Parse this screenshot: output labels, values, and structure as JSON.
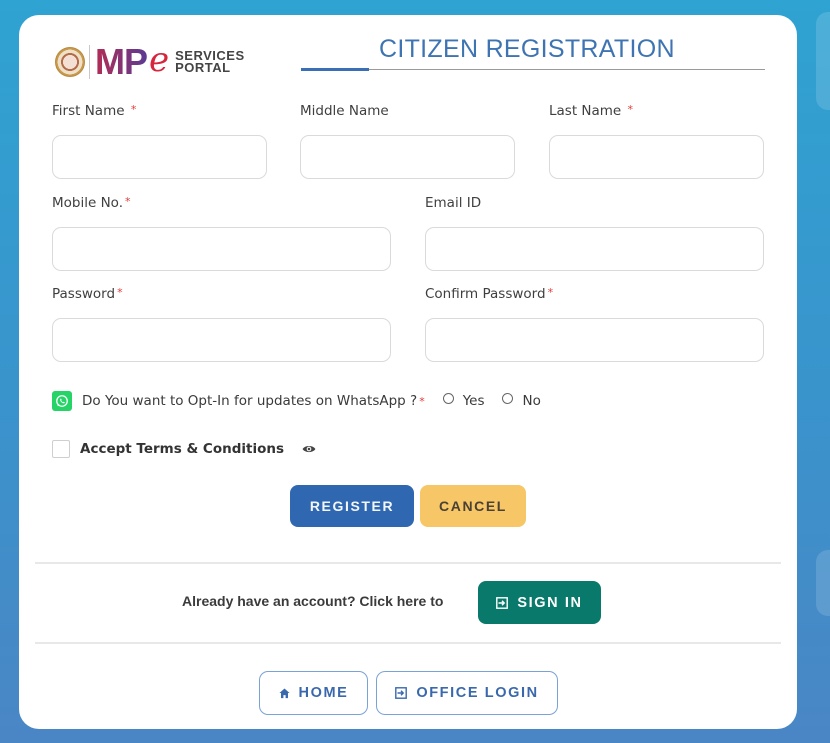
{
  "header": {
    "logo": {
      "mp": "MP",
      "e": "e",
      "line1": "SERVICES",
      "line2": "PORTAL",
      "emblem_icon": "mp-state-emblem"
    },
    "title": "CITIZEN REGISTRATION"
  },
  "form": {
    "required_marker": "*",
    "first_name": {
      "label": "First Name",
      "required": true,
      "value": "",
      "placeholder": ""
    },
    "middle_name": {
      "label": "Middle Name",
      "required": false,
      "value": "",
      "placeholder": ""
    },
    "last_name": {
      "label": "Last Name",
      "required": true,
      "value": "",
      "placeholder": ""
    },
    "mobile": {
      "label": "Mobile No.",
      "required": true,
      "value": "",
      "placeholder": ""
    },
    "email": {
      "label": "Email ID",
      "required": false,
      "value": "",
      "placeholder": ""
    },
    "password": {
      "label": "Password",
      "required": true,
      "value": "",
      "placeholder": ""
    },
    "confirm_password": {
      "label": "Confirm Password",
      "required": true,
      "value": "",
      "placeholder": ""
    },
    "whatsapp": {
      "icon": "whatsapp-icon",
      "question": "Do You want to Opt-In for updates on WhatsApp ?",
      "required": true,
      "options": [
        "Yes",
        "No"
      ],
      "selected": null
    },
    "terms": {
      "label": "Accept Terms & Conditions",
      "checked": false,
      "view_icon": "eye-icon"
    }
  },
  "actions": {
    "register": "REGISTER",
    "cancel": "CANCEL"
  },
  "signin": {
    "prompt": "Already have an account? Click here to",
    "button": "SIGN IN",
    "icon": "login-icon"
  },
  "footer_nav": {
    "home": {
      "label": "HOME",
      "icon": "home-icon"
    },
    "office_login": {
      "label": "OFFICE LOGIN",
      "icon": "login-icon"
    }
  },
  "colors": {
    "primary": "#2f68b0",
    "title": "#3f74b3",
    "warning": "#f6c667",
    "success": "#08796a",
    "required": "#e13b3b",
    "whatsapp": "#25d366"
  }
}
